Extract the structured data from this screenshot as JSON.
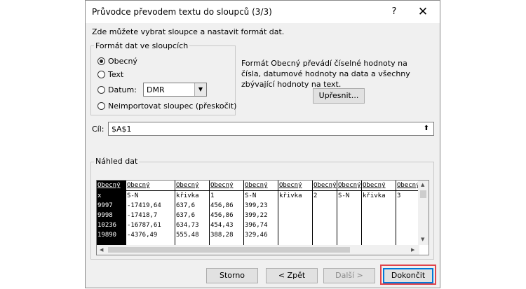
{
  "dialog": {
    "title": "Průvodce převodem textu do sloupců (3/3)",
    "help_label": "?",
    "close_label": "✕",
    "intro_text": "Zde můžete vybrat sloupce a nastavit formát dat."
  },
  "format_group": {
    "label": "Formát dat ve sloupcích",
    "options": [
      "Obecný",
      "Text",
      "Datum:",
      "Neimportovat sloupec (přeskočit)"
    ],
    "selected_index": 0,
    "date_format": "DMR"
  },
  "description": "Formát Obecný převádí číselné hodnoty na čísla, datumové hodnoty na data a všechny zbývající hodnoty na text.",
  "buttons": {
    "advanced": "Upřesnit...",
    "cancel": "Storno",
    "back": "< Zpět",
    "next": "Další >",
    "finish": "Dokončit"
  },
  "destination": {
    "label": "Cíl:",
    "value": "$A$1"
  },
  "preview": {
    "label": "Náhled dat",
    "columns": [
      {
        "header": "Obecný",
        "cells": [
          "x",
          "9997",
          "9998",
          "10236",
          "19890"
        ]
      },
      {
        "header": "Obecný",
        "cells": [
          "S-N",
          "-17419,64",
          "-17418,7",
          "-16787,61",
          "-4376,49"
        ]
      },
      {
        "header": "Obecný",
        "cells": [
          "křivka",
          "637,6",
          "637,6",
          "634,73",
          "555,48"
        ]
      },
      {
        "header": "Obecný",
        "cells": [
          "1",
          "456,86",
          "456,86",
          "454,43",
          "388,28"
        ]
      },
      {
        "header": "Obecný",
        "cells": [
          "S-N",
          "399,23",
          "399,22",
          "396,74",
          "329,46"
        ]
      },
      {
        "header": "Obecný",
        "cells": [
          "křivka",
          "",
          "",
          "",
          ""
        ]
      },
      {
        "header": "Obecný",
        "cells": [
          "2",
          "",
          "",
          "",
          ""
        ]
      },
      {
        "header": "Obecný",
        "cells": [
          "S-N",
          "",
          "",
          "",
          ""
        ]
      },
      {
        "header": "Obecný",
        "cells": [
          "křivka",
          "",
          "",
          "",
          ""
        ]
      },
      {
        "header": "Obecný",
        "cells": [
          "3",
          "",
          "",
          "",
          ""
        ]
      }
    ]
  },
  "colors": {
    "dialog_bg": "#f0f0f0",
    "button_bg": "#e1e1e1",
    "focus_blue": "#0078d7",
    "highlight_red": "#e0444c"
  }
}
